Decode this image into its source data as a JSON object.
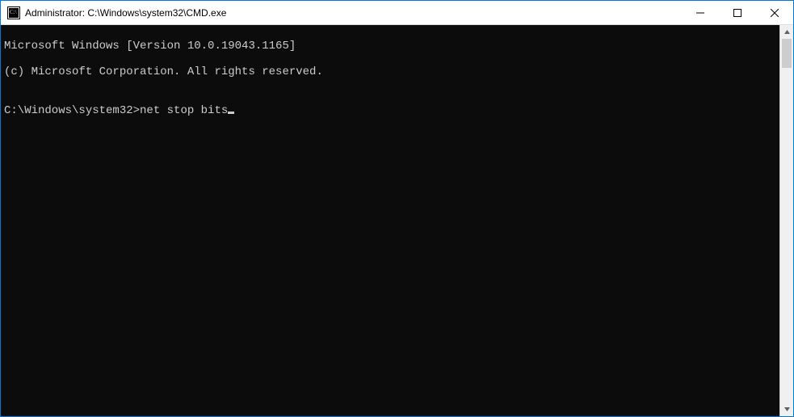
{
  "titlebar": {
    "title": "Administrator: C:\\Windows\\system32\\CMD.exe"
  },
  "terminal": {
    "line1": "Microsoft Windows [Version 10.0.19043.1165]",
    "line2": "(c) Microsoft Corporation. All rights reserved.",
    "blank": "",
    "prompt": "C:\\Windows\\system32>",
    "command": "net stop bits"
  }
}
